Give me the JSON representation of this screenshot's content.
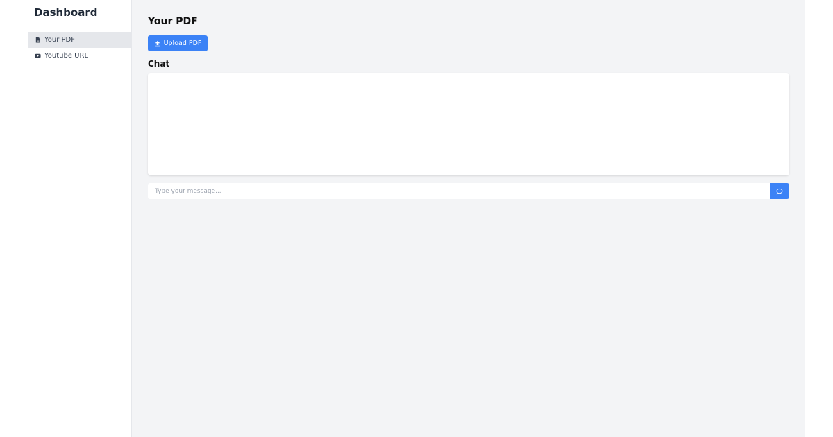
{
  "sidebar": {
    "title": "Dashboard",
    "items": [
      {
        "label": "Your PDF",
        "icon": "file-pdf-icon",
        "active": true
      },
      {
        "label": "Youtube URL",
        "icon": "youtube-icon",
        "active": false
      }
    ]
  },
  "main": {
    "title": "Your PDF",
    "upload_button": {
      "label": "Upload PDF",
      "icon": "upload-icon"
    },
    "chat": {
      "title": "Chat",
      "input_placeholder": "Type your message...",
      "send_icon": "message-icon"
    }
  },
  "colors": {
    "accent": "#3b82f6",
    "sidebar_active": "#e5e7eb",
    "main_bg": "#f3f4f6"
  }
}
